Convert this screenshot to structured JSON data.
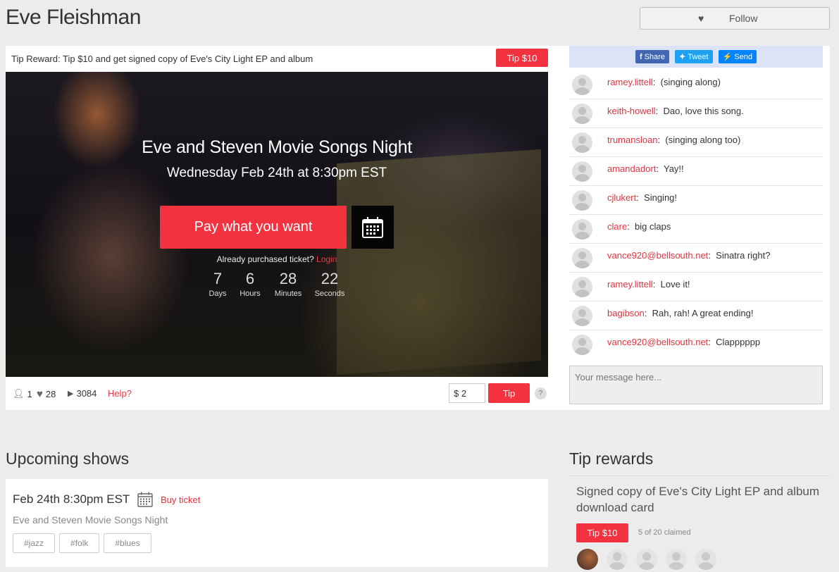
{
  "header": {
    "artist_name": "Eve Fleishman",
    "follow_label": "Follow"
  },
  "tip_reward_bar": {
    "label": "Tip Reward:",
    "text": "Tip $10 and get signed copy of Eve's City Light EP and album",
    "button": "Tip $10"
  },
  "video": {
    "title": "Eve and Steven Movie Songs Night",
    "date": "Wednesday Feb 24th at 8:30pm EST",
    "pay_button": "Pay what you want",
    "already_text": "Already purchased ticket?",
    "login_link": "Login",
    "countdown": [
      {
        "value": "7",
        "label": "Days"
      },
      {
        "value": "6",
        "label": "Hours"
      },
      {
        "value": "28",
        "label": "Minutes"
      },
      {
        "value": "22",
        "label": "Seconds"
      }
    ]
  },
  "stats": {
    "viewers": "1",
    "likes": "28",
    "plays": "3084",
    "help": "Help?",
    "tip_amount": "$ 2",
    "tip_button": "Tip",
    "question": "?"
  },
  "share": {
    "facebook": "Share",
    "twitter": "Tweet",
    "messenger": "Send"
  },
  "chat": {
    "messages": [
      {
        "user": "ramey.littell",
        "text": "(singing along)"
      },
      {
        "user": "keith-howell",
        "text": "Dao, love this song."
      },
      {
        "user": "trumansloan",
        "text": "(singing along too)"
      },
      {
        "user": "amandadort",
        "text": "Yay!!"
      },
      {
        "user": "cjlukert",
        "text": "Singing!"
      },
      {
        "user": "clare",
        "text": "big claps"
      },
      {
        "user": "vance920@bellsouth.net",
        "text": "Sinatra right?"
      },
      {
        "user": "ramey.littell",
        "text": "Love it!"
      },
      {
        "user": "bagibson",
        "text": "Rah, rah! A great ending!"
      },
      {
        "user": "vance920@bellsouth.net",
        "text": "Clapppppp"
      }
    ],
    "input_placeholder": "Your message here..."
  },
  "upcoming": {
    "title": "Upcoming shows",
    "shows": [
      {
        "date": "Feb 24th 8:30pm EST",
        "buy": "Buy ticket",
        "name": "Eve and Steven Movie Songs Night",
        "tags": [
          "#jazz",
          "#folk",
          "#blues"
        ]
      }
    ]
  },
  "rewards": {
    "title": "Tip rewards",
    "description": "Signed copy of Eve's City Light EP and album download card",
    "button": "Tip $10",
    "claimed": "5 of 20 claimed"
  },
  "colors": {
    "accent": "#f2323f",
    "background": "#ececec",
    "share_bar": "#dde3f7"
  }
}
